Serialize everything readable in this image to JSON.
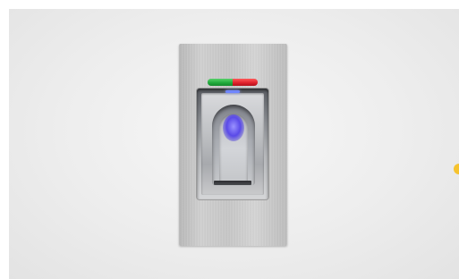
{
  "scene": {
    "subject": "fingerprint-reader",
    "colors": {
      "background": "#ededed",
      "plate": "#c6c6c6",
      "led_green": "#1fa83a",
      "led_red": "#dd1f2a",
      "sensor_glow": "#5a4ae8",
      "indicator_dot": "#f6c32e"
    }
  }
}
